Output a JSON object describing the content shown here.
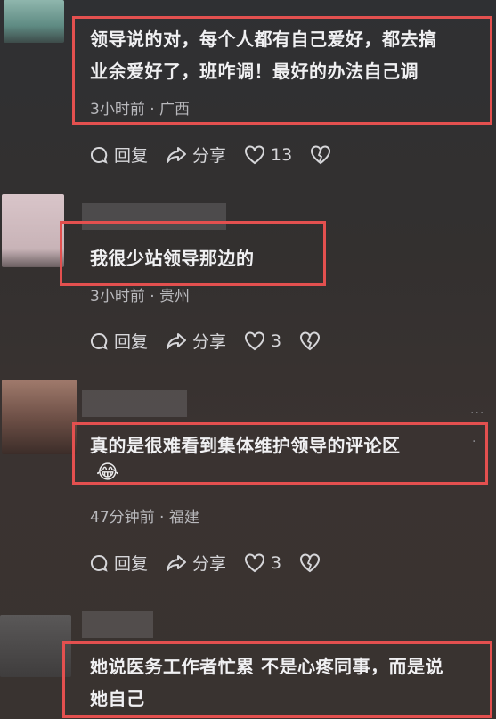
{
  "comments": [
    {
      "text": "领导说的对，每个人都有自己爱好，都去搞业余爱好了，班咋调！最好的办法自己调",
      "line1": "领导说的对，每个人都有自己爱好，都去搞",
      "line2": "业余爱好了，班咋调！最好的办法自己调",
      "meta": "3小时前 · 广西",
      "reply": "回复",
      "share": "分享",
      "likes": "13"
    },
    {
      "text": "我很少站领导那边的",
      "meta": "3小时前 · 贵州",
      "reply": "回复",
      "share": "分享",
      "likes": "3"
    },
    {
      "text": "真的是很难看到集体维护领导的评论区",
      "emoji": "😂",
      "meta": "47分钟前 · 福建",
      "reply": "回复",
      "share": "分享",
      "likes": "3"
    },
    {
      "line1": "她说医务工作者忙累 不是心疼同事，而是说",
      "line2": "她自己"
    }
  ],
  "colors": {
    "highlight": "#e3504f",
    "text": "#f0f0f2",
    "meta": "#b9b9bd"
  }
}
